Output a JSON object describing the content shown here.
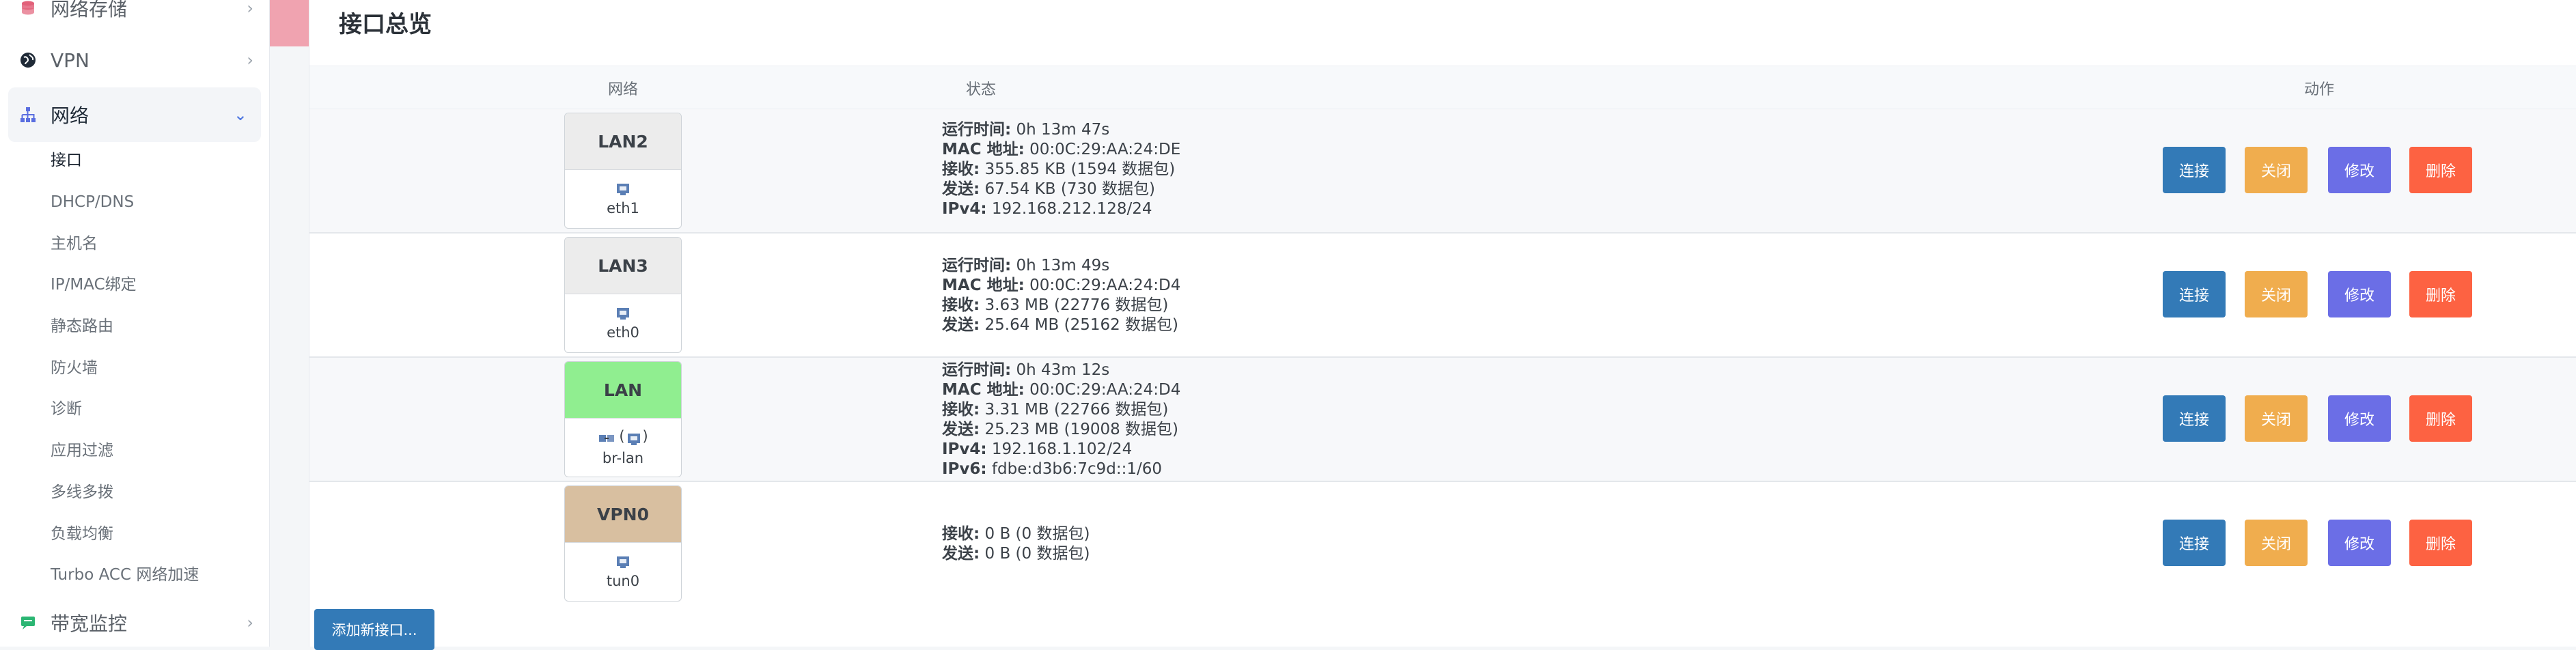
{
  "sidebar": {
    "top_items": [
      {
        "label": "网络存储"
      },
      {
        "label": "VPN"
      },
      {
        "label": "网络"
      }
    ],
    "network_sub_items": [
      {
        "label": "接口"
      },
      {
        "label": "DHCP/DNS"
      },
      {
        "label": "主机名"
      },
      {
        "label": "IP/MAC绑定"
      },
      {
        "label": "静态路由"
      },
      {
        "label": "防火墙"
      },
      {
        "label": "诊断"
      },
      {
        "label": "应用过滤"
      },
      {
        "label": "多线多拨"
      },
      {
        "label": "负载均衡"
      },
      {
        "label": "Turbo ACC 网络加速"
      }
    ],
    "bottom_item": {
      "label": "带宽监控"
    }
  },
  "page": {
    "title": "接口总览",
    "columns": {
      "network": "网络",
      "status": "状态",
      "actions": "动作"
    }
  },
  "interfaces": [
    {
      "name": "LAN2",
      "device": "eth1",
      "head_color": "#ececec",
      "status": [
        {
          "k": "运行时间:",
          "v": "0h 13m 47s"
        },
        {
          "k": "MAC 地址:",
          "v": "00:0C:29:AA:24:DE"
        },
        {
          "k": "接收:",
          "v": "355.85 KB (1594 数据包)"
        },
        {
          "k": "发送:",
          "v": "67.54 KB (730 数据包)"
        },
        {
          "k": "IPv4:",
          "v": "192.168.212.128/24"
        }
      ]
    },
    {
      "name": "LAN3",
      "device": "eth0",
      "head_color": "#ececec",
      "status": [
        {
          "k": "运行时间:",
          "v": "0h 13m 49s"
        },
        {
          "k": "MAC 地址:",
          "v": "00:0C:29:AA:24:D4"
        },
        {
          "k": "接收:",
          "v": "3.63 MB (22776 数据包)"
        },
        {
          "k": "发送:",
          "v": "25.64 MB (25162 数据包)"
        }
      ]
    },
    {
      "name": "LAN",
      "device": "br-lan",
      "device_prefix": "(",
      "device_suffix": ")",
      "head_color": "#90ee90",
      "status": [
        {
          "k": "运行时间:",
          "v": "0h 43m 12s"
        },
        {
          "k": "MAC 地址:",
          "v": "00:0C:29:AA:24:D4"
        },
        {
          "k": "接收:",
          "v": "3.31 MB (22766 数据包)"
        },
        {
          "k": "发送:",
          "v": "25.23 MB (19008 数据包)"
        },
        {
          "k": "IPv4:",
          "v": "192.168.1.102/24"
        },
        {
          "k": "IPv6:",
          "v": "fdbe:d3b6:7c9d::1/60"
        }
      ]
    },
    {
      "name": "VPN0",
      "device": "tun0",
      "head_color": "#d8bfa0",
      "status": [
        {
          "k": "接收:",
          "v": "0 B (0 数据包)"
        },
        {
          "k": "发送:",
          "v": "0 B (0 数据包)"
        }
      ]
    }
  ],
  "actions": {
    "connect": "连接",
    "stop": "关闭",
    "edit": "修改",
    "delete": "删除"
  },
  "add_button": "添加新接口...",
  "colors": {
    "primary": "#337ab7",
    "warning": "#f0ad4e",
    "edit": "#6b6ee6",
    "danger": "#fd6242",
    "accent_pink": "#f0a3b0"
  }
}
